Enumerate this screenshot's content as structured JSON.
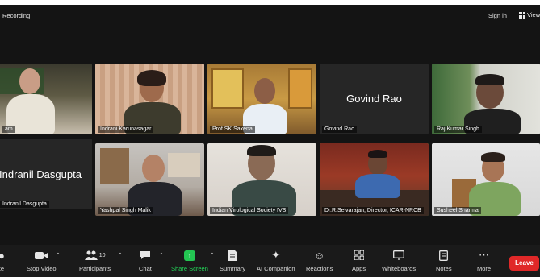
{
  "topbar": {
    "recording_label": "Recording",
    "signin_label": "Sign in",
    "view_label": "View"
  },
  "participants": [
    {
      "name": "am",
      "kind": "video"
    },
    {
      "name": "Indrani Karunasagar",
      "kind": "video"
    },
    {
      "name": "Prof SK Saxena",
      "kind": "video"
    },
    {
      "name": "Govind Rao",
      "kind": "avatar",
      "display": "Govind Rao"
    },
    {
      "name": "Raj Kumar Singh",
      "kind": "video"
    },
    {
      "name": "Indranil Dasgupta",
      "kind": "avatar",
      "display": "Indranil Dasgupta"
    },
    {
      "name": "Yashpal Singh Malik",
      "kind": "video"
    },
    {
      "name": "Indian Virological Society IVS",
      "kind": "video"
    },
    {
      "name": "Dr.R.Selvarajan, Director, ICAR-NRCB",
      "kind": "video",
      "active": true
    },
    {
      "name": "Susheel Sharma",
      "kind": "video"
    }
  ],
  "toolbar": {
    "mute_label": "te",
    "video_label": "Stop Video",
    "participants_label": "Participants",
    "participants_count": "10",
    "chat_label": "Chat",
    "share_label": "Share Screen",
    "summary_label": "Summary",
    "ai_label": "AI Companion",
    "reactions_label": "Reactions",
    "apps_label": "Apps",
    "whiteboards_label": "Whiteboards",
    "notes_label": "Notes",
    "more_label": "More",
    "leave_label": "Leave"
  },
  "colors": {
    "active_speaker": "#23d959",
    "share_accent": "#23c552",
    "leave": "#e02828"
  }
}
